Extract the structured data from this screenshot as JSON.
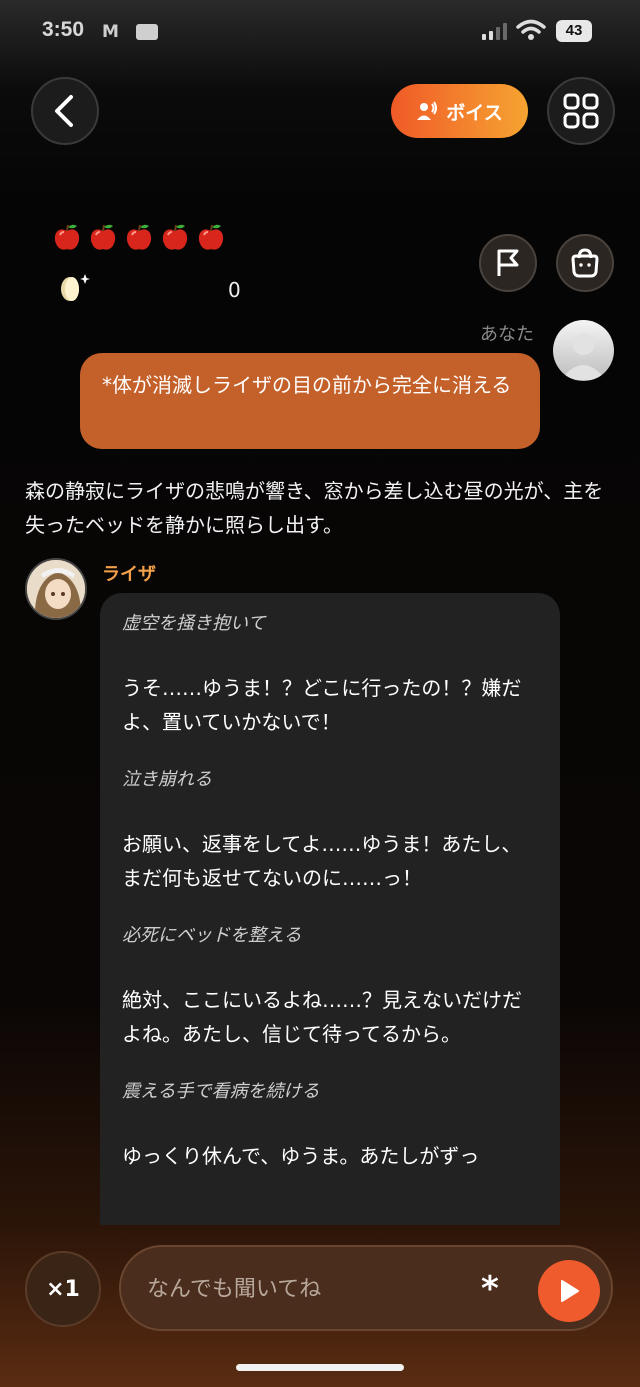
{
  "status_bar": {
    "time": "3:50",
    "battery": "43"
  },
  "header": {
    "voice_label": "ボイス"
  },
  "stats": {
    "apples": 5,
    "coin_count": "0"
  },
  "user_message": {
    "label": "あなた",
    "text": "*体が消滅しライザの目の前から完全に消える"
  },
  "narration": "森の静寂にライザの悲鳴が響き、窓から差し込む昼の光が、主を失ったベッドを静かに照らし出す。",
  "character": {
    "name": "ライザ",
    "blocks": [
      {
        "type": "action",
        "text": "虚空を掻き抱いて"
      },
      {
        "type": "line",
        "text": "うそ……ゆうま！？どこに行ったの！？嫌だよ、置いていかないで！"
      },
      {
        "type": "action",
        "text": "泣き崩れる"
      },
      {
        "type": "line",
        "text": "お願い、返事をしてよ……ゆうま！あたし、まだ何も返せてないのに……っ！"
      },
      {
        "type": "action",
        "text": "必死にベッドを整える"
      },
      {
        "type": "line",
        "text": "絶対、ここにいるよね……？見えないだけだよね。あたし、信じて待ってるから。"
      },
      {
        "type": "action",
        "text": "震える手で看病を続ける"
      },
      {
        "type": "line",
        "text": "ゆっくり休んで、ゆうま。あたしがずっ"
      }
    ]
  },
  "composer": {
    "speed_label": "×1",
    "placeholder": "なんでも聞いてね",
    "asterisk": "*"
  },
  "colors": {
    "accent": "#ef5b2c",
    "user_bubble": "#c4612a",
    "char_name": "#f3a04a"
  }
}
